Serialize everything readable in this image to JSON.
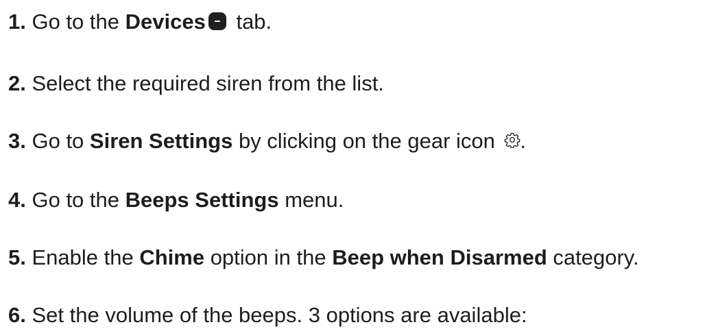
{
  "steps": [
    {
      "num": "1.",
      "t1": " Go to the ",
      "b1": "Devices",
      "t2": " tab.",
      "icon": "devices-tab-icon"
    },
    {
      "num": "2.",
      "t1": " Select the required siren from the list."
    },
    {
      "num": "3.",
      "t1": " Go to ",
      "b1": "Siren Settings",
      "t2": " by clicking on the gear icon ",
      "t3": ".",
      "icon": "gear-icon"
    },
    {
      "num": "4.",
      "t1": " Go to the ",
      "b1": "Beeps Settings",
      "t2": " menu."
    },
    {
      "num": "5.",
      "t1": " Enable the ",
      "b1": "Chime",
      "t2": " option in the ",
      "b2": "Beep when Disarmed",
      "t3": " category."
    },
    {
      "num": "6.",
      "t1": " Set the volume of the beeps. 3 options are available:"
    }
  ]
}
